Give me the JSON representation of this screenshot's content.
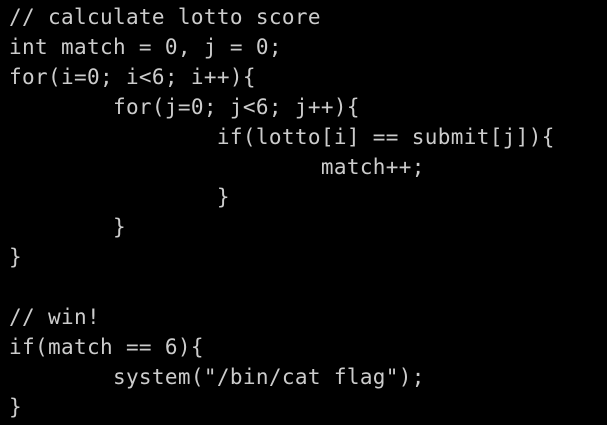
{
  "terminal": {
    "lines": [
      "// calculate lotto score",
      "int match = 0, j = 0;",
      "for(i=0; i<6; i++){",
      "        for(j=0; j<6; j++){",
      "                if(lotto[i] == submit[j]){",
      "                        match++;",
      "                }",
      "        }",
      "}",
      "",
      "// win!",
      "if(match == 6){",
      "        system(\"/bin/cat flag\");",
      "}"
    ]
  },
  "colors": {
    "background": "#000000",
    "text": "#cccccc"
  }
}
